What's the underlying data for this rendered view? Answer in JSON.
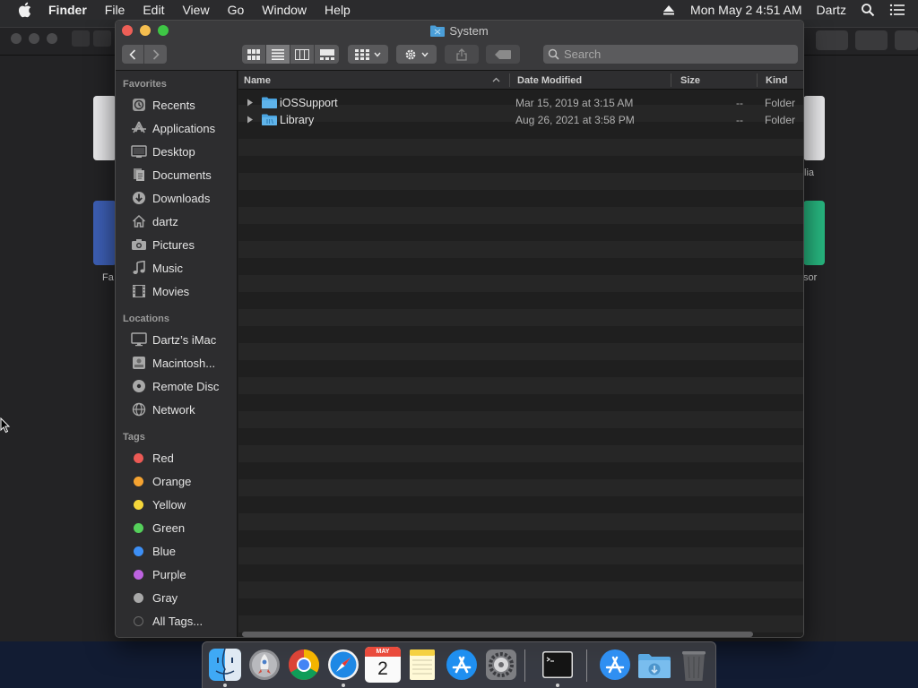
{
  "menubar": {
    "app_name": "Finder",
    "items": [
      "File",
      "Edit",
      "View",
      "Go",
      "Window",
      "Help"
    ],
    "clock": "Mon May 2  4:51 AM",
    "user": "Dartz"
  },
  "background_app": {
    "tile_labels": [
      "Fa",
      "lia",
      "sor"
    ]
  },
  "finder": {
    "title": "System",
    "search_placeholder": "Search",
    "sidebar": {
      "favorites_header": "Favorites",
      "favorites": [
        {
          "label": "Recents",
          "icon": "clock-icon"
        },
        {
          "label": "Applications",
          "icon": "applications-icon"
        },
        {
          "label": "Desktop",
          "icon": "desktop-icon"
        },
        {
          "label": "Documents",
          "icon": "documents-icon"
        },
        {
          "label": "Downloads",
          "icon": "downloads-icon"
        },
        {
          "label": "dartz",
          "icon": "home-icon"
        },
        {
          "label": "Pictures",
          "icon": "camera-icon"
        },
        {
          "label": "Music",
          "icon": "music-note-icon"
        },
        {
          "label": "Movies",
          "icon": "film-icon"
        }
      ],
      "locations_header": "Locations",
      "locations": [
        {
          "label": "Dartz’s iMac",
          "icon": "imac-icon"
        },
        {
          "label": "Macintosh...",
          "icon": "hard-drive-icon"
        },
        {
          "label": "Remote Disc",
          "icon": "disc-icon"
        },
        {
          "label": "Network",
          "icon": "globe-icon"
        }
      ],
      "tags_header": "Tags",
      "tags": [
        {
          "label": "Red",
          "color": "#ec5a55"
        },
        {
          "label": "Orange",
          "color": "#f5a331"
        },
        {
          "label": "Yellow",
          "color": "#f5d63a"
        },
        {
          "label": "Green",
          "color": "#55d05b"
        },
        {
          "label": "Blue",
          "color": "#3d8ff5"
        },
        {
          "label": "Purple",
          "color": "#bd63e0"
        },
        {
          "label": "Gray",
          "color": "#a8a8a8"
        },
        {
          "label": "All Tags...",
          "color": "#5a5a5a"
        }
      ]
    },
    "columns": {
      "name": "Name",
      "date": "Date Modified",
      "size": "Size",
      "kind": "Kind"
    },
    "rows": [
      {
        "name": "iOSSupport",
        "date": "Mar 15, 2019 at 3:15 AM",
        "size": "--",
        "kind": "Folder"
      },
      {
        "name": "Library",
        "date": "Aug 26, 2021 at 3:58 PM",
        "size": "--",
        "kind": "Folder"
      }
    ]
  },
  "dock": {
    "apps": [
      "finder-icon",
      "launchpad-icon",
      "chrome-icon",
      "safari-icon",
      "calendar-icon",
      "notes-icon",
      "app-store-icon",
      "system-preferences-icon",
      "terminal-icon",
      "applications-folder-icon",
      "downloads-folder-icon",
      "trash-icon"
    ],
    "calendar_month": "MAY",
    "calendar_day": "2"
  }
}
